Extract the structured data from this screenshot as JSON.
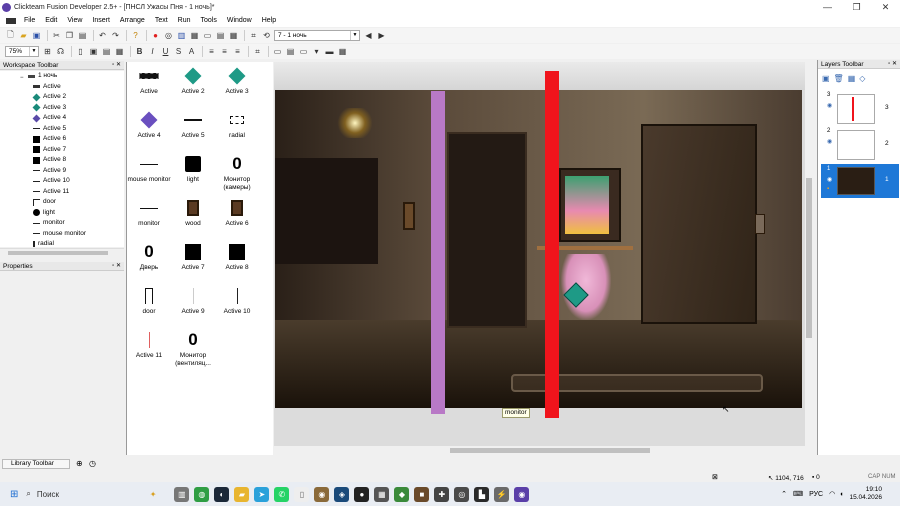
{
  "window": {
    "title": "Clickteam Fusion Developer 2.5+ - [ПНСЛ Ужасы Пня - 1 ночь]*",
    "min": "—",
    "max": "❐",
    "close": "✕"
  },
  "menu": [
    "File",
    "Edit",
    "View",
    "Insert",
    "Arrange",
    "Text",
    "Run",
    "Tools",
    "Window",
    "Help"
  ],
  "toolbar": {
    "zoom": "75%",
    "frame_select": "7 - 1 ночь"
  },
  "workspace": {
    "title": "Workspace Toolbar",
    "items": [
      {
        "label": "1 ночь",
        "icon": "frame-icon"
      },
      {
        "label": "Active",
        "icon": "active-icon"
      },
      {
        "label": "Active 2",
        "icon": "diamond-icon"
      },
      {
        "label": "Active 3",
        "icon": "diamond-icon"
      },
      {
        "label": "Active 4",
        "icon": "diamond-icon"
      },
      {
        "label": "Active 5",
        "icon": "line-icon"
      },
      {
        "label": "Active 6",
        "icon": "square-icon"
      },
      {
        "label": "Active 7",
        "icon": "square-icon"
      },
      {
        "label": "Active 8",
        "icon": "square-icon"
      },
      {
        "label": "Active 9",
        "icon": "line-icon"
      },
      {
        "label": "Active 10",
        "icon": "line-icon"
      },
      {
        "label": "Active 11",
        "icon": "line-icon"
      },
      {
        "label": "door",
        "icon": "door-icon"
      },
      {
        "label": "light",
        "icon": "circle-icon"
      },
      {
        "label": "monitor",
        "icon": "line-icon"
      },
      {
        "label": "mouse monitor",
        "icon": "line-icon"
      },
      {
        "label": "radial",
        "icon": "radial-icon"
      }
    ]
  },
  "properties": {
    "title": "Properties"
  },
  "library": {
    "items": [
      {
        "label": "Active",
        "glyph": "▬"
      },
      {
        "label": "Active 2",
        "glyph": "◆"
      },
      {
        "label": "Active 3",
        "glyph": "◆"
      },
      {
        "label": "Active 4",
        "glyph": "◆"
      },
      {
        "label": "Active 5",
        "glyph": "━"
      },
      {
        "label": "radial",
        "glyph": "[ ]"
      },
      {
        "label": "mouse monitor",
        "glyph": "─"
      },
      {
        "label": "light",
        "glyph": "●"
      },
      {
        "label": "Монитор (камеры)",
        "glyph": "0"
      },
      {
        "label": "monitor",
        "glyph": "─"
      },
      {
        "label": "wood",
        "glyph": "▮"
      },
      {
        "label": "Active 6",
        "glyph": "▮"
      },
      {
        "label": "Дверь",
        "glyph": "0"
      },
      {
        "label": "Active 7",
        "glyph": "■"
      },
      {
        "label": "Active 8",
        "glyph": "■"
      },
      {
        "label": "door",
        "glyph": "┌"
      },
      {
        "label": "Active 9",
        "glyph": "│"
      },
      {
        "label": "Active 10",
        "glyph": "│"
      },
      {
        "label": "Active 11",
        "glyph": "│"
      },
      {
        "label": "Монитор (вентиляц...",
        "glyph": "0"
      }
    ],
    "footer_label": "Library Toolbar"
  },
  "frame": {
    "monitor_label": "monitor"
  },
  "layers": {
    "title": "Layers Toolbar",
    "rows": [
      {
        "num": "3"
      },
      {
        "num": "2"
      },
      {
        "num": "1"
      }
    ]
  },
  "status": {
    "coords": "1104, 716",
    "count": "0",
    "caps": "CAP NUM"
  },
  "taskbar": {
    "search": "Поиск",
    "lang": "РУС",
    "time": "19:10",
    "date": "15.04.2026"
  },
  "colors": {
    "purple_bar": "#b879c6",
    "red_bar": "#f0141c",
    "selected_layer": "#1e78d7"
  }
}
